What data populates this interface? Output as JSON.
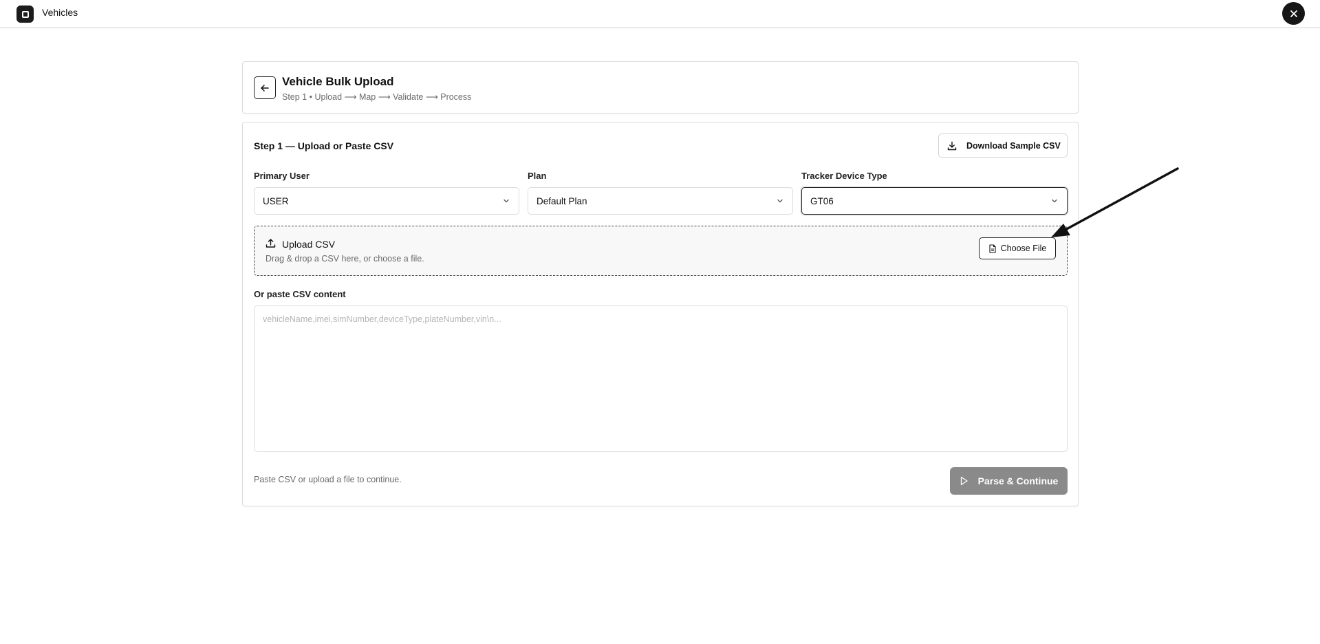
{
  "app": {
    "title": "Vehicles",
    "logo_icon": "square-logo-icon",
    "close_icon": "close-icon"
  },
  "header": {
    "title": "Vehicle Bulk Upload",
    "subtitle": "Step 1 • Upload ⟶ Map ⟶ Validate ⟶ Process",
    "back_icon": "arrow-left-icon"
  },
  "step": {
    "title": "Step 1 — Upload or Paste CSV",
    "download_button_label": "Download Sample CSV",
    "download_icon": "download-icon"
  },
  "fields": {
    "primary_user": {
      "label": "Primary User",
      "value": "USER"
    },
    "plan": {
      "label": "Plan",
      "value": "Default Plan"
    },
    "tracker_device_type": {
      "label": "Tracker Device Type",
      "value": "GT06"
    }
  },
  "upload": {
    "title": "Upload CSV",
    "hint": "Drag & drop a CSV here, or choose a file.",
    "choose_button_label": "Choose File",
    "upload_icon": "upload-icon",
    "file_icon": "file-icon"
  },
  "paste": {
    "label": "Or paste CSV content",
    "placeholder": "vehicleName,imei,simNumber,deviceType,plateNumber,vin\\n...",
    "value": ""
  },
  "footer": {
    "hint": "Paste CSV or upload a file to continue.",
    "parse_button_label": "Parse & Continue",
    "parse_icon": "play-icon",
    "parse_disabled": true
  },
  "colors": {
    "primary_dark": "#161616",
    "disabled_button": "#8a8a8a",
    "muted_text": "#6a6a6a",
    "border": "#dcdcdc"
  }
}
